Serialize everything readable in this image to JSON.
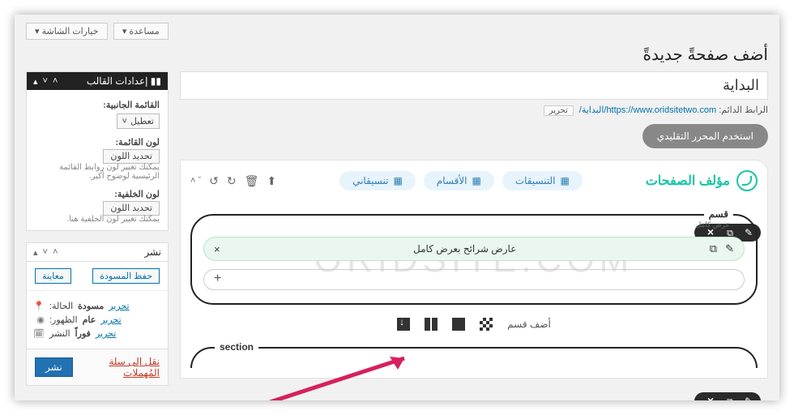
{
  "top": {
    "help": "مساعدة ▾",
    "screen_opts": "خيارات الشاشة ▾"
  },
  "page": {
    "heading": "أضف صفحةً جديدةً",
    "title_value": "البداية"
  },
  "permalink": {
    "label": "الرابط الدائم:",
    "base": "https://www.oridsitetwo.com",
    "slug": "/البداية/",
    "edit": "تحرير"
  },
  "classic_editor_btn": "استخدم المحرر التقليدي",
  "builder": {
    "brand": "مؤلف الصفحات",
    "pills": {
      "formats": "التنسيقات",
      "sections": "الأقسام",
      "consistency": "تنسيقاني"
    },
    "section_legend": "قسم",
    "section_sub": "عرض كامل",
    "slider_label": "عارض شرائح بعرض كامل",
    "add_section": "أضف قسم",
    "section2_legend": "section"
  },
  "sidebar": {
    "template": {
      "title": "إعدادات القالب",
      "side_menu_label": "القائمة الجانبية:",
      "side_menu_value": "تعطيل",
      "menu_color_label": "لون القائمة:",
      "pick_color": "تحديد اللون",
      "menu_hint": "يمكنك تغيير لون روابط القائمة الرئيسية لوضوح أكبر.",
      "bg_color_label": "لون الخلفية:",
      "bg_hint": "يمكنك تغيير لون الخلفية هنا."
    },
    "publish": {
      "title": "نشر",
      "save_draft": "حفظ المسودة",
      "preview": "معاينة",
      "status_label": "الحالة:",
      "status_value": "مسودة",
      "visibility_label": "الظهور:",
      "visibility_value": "عام",
      "schedule_label": "النشر",
      "schedule_value": "فوراً",
      "edit_link": "تحرير",
      "trash": "نقل إلى سلة المُهملات",
      "publish_btn": "نشر"
    }
  },
  "watermark": "ORIDSITE.COM"
}
